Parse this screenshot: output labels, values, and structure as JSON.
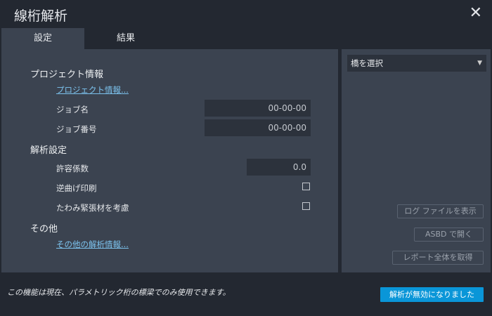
{
  "window": {
    "title": "線桁解析",
    "close_icon": "close-icon"
  },
  "tabs": [
    {
      "label": "設定",
      "active": true
    },
    {
      "label": "結果",
      "active": false
    }
  ],
  "settings": {
    "project_section": "プロジェクト情報",
    "project_link": "プロジェクト情報...",
    "job_name_label": "ジョブ名",
    "job_name_value": "00-00-00",
    "job_number_label": "ジョブ番号",
    "job_number_value": "00-00-00",
    "analysis_section": "解析設定",
    "tolerance_label": "許容係数",
    "tolerance_value": "0.0",
    "reverse_camber_label": "逆曲げ印刷",
    "reverse_camber_checked": false,
    "deflection_label": "たわみ緊張材を考慮",
    "deflection_checked": false,
    "other_section": "その他",
    "other_link": "その他の解析情報..."
  },
  "right_panel": {
    "bridge_select": "橋を選択",
    "log_button": "ログ ファイルを表示",
    "asbd_button": "ASBD で開く",
    "report_button": "レポート全体を取得"
  },
  "footer": {
    "notice": "この機能は現在、パラメトリック桁の標梁でのみ使用できます。",
    "analysis_button": "解析が無効になりました"
  },
  "colors": {
    "accent": "#0a96d8",
    "link": "#7cc3ee",
    "panel": "#3b4350",
    "background": "#232831"
  }
}
